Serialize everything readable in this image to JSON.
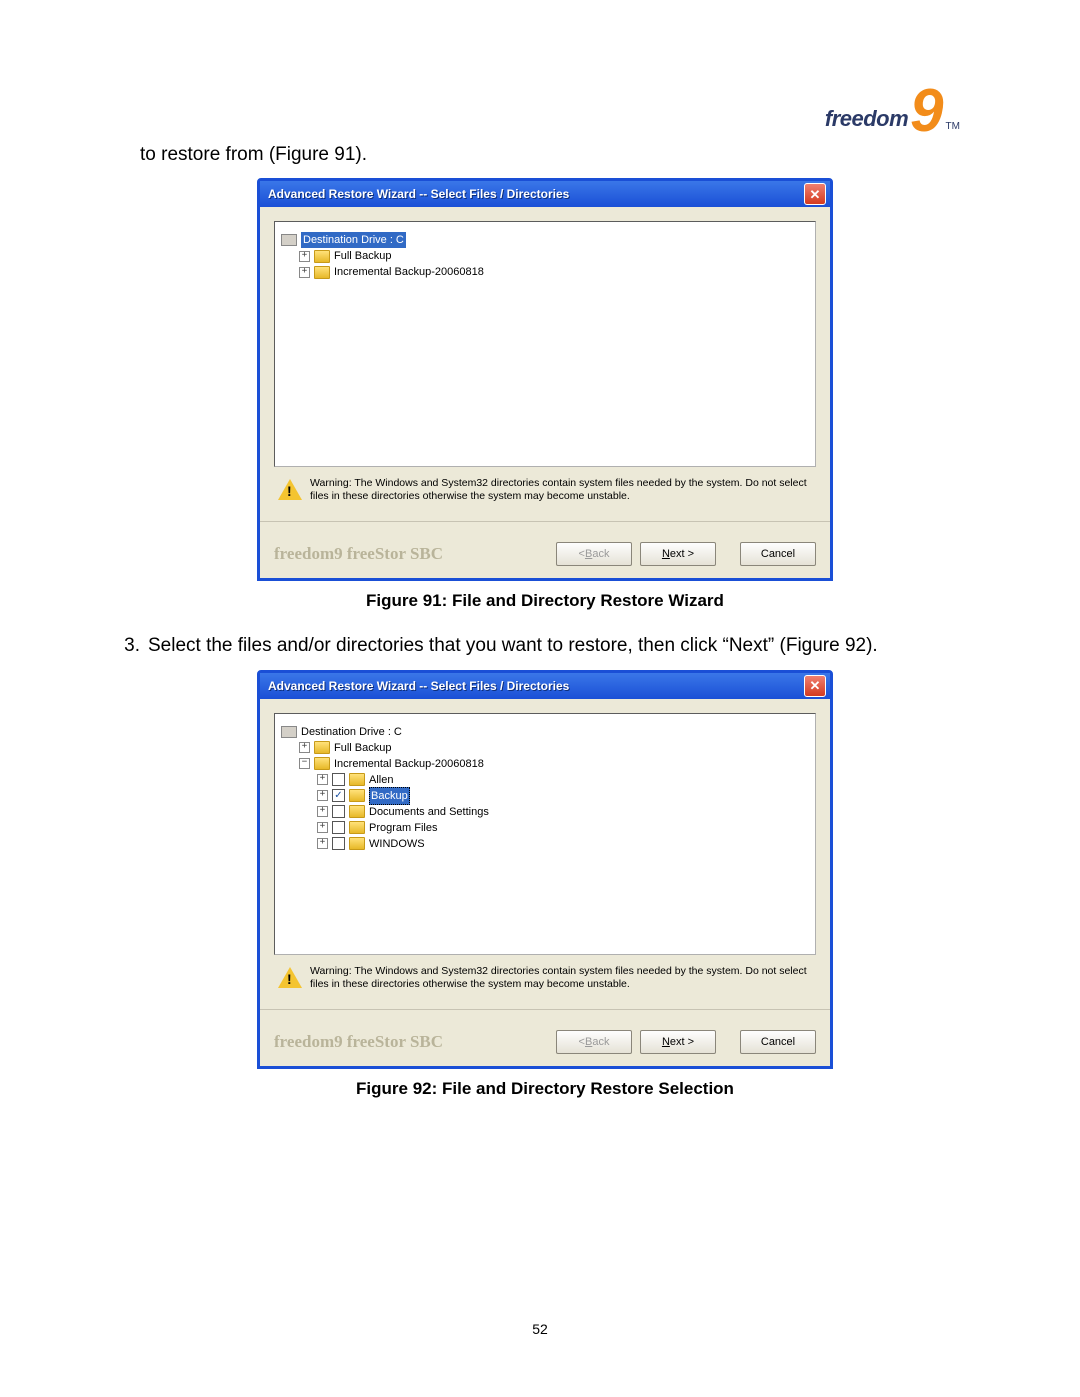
{
  "logo": {
    "word": "freedom",
    "nine": "9",
    "tm": "TM"
  },
  "intro": "to restore from (Figure 91).",
  "step3_num": "3.",
  "step3_text": "Select the files and/or directories that you want to restore, then click “Next” (Figure 92).",
  "page_number": "52",
  "dialog_title": "Advanced Restore Wizard -- Select Files / Directories",
  "close_glyph": "✕",
  "warning_text": "Warning: The Windows and System32 directories contain system files needed by the system. Do not select files in these directories otherwise the system may become unstable.",
  "footer_brand": "freedom9 freeStor SBC",
  "btn_back": "< Back",
  "btn_back_u": "B",
  "btn_next": "Next >",
  "btn_next_u": "N",
  "btn_cancel": "Cancel",
  "fig91": {
    "caption": "Figure 91: File and Directory Restore Wizard",
    "root": "Destination Drive : C",
    "items": [
      {
        "exp": "+",
        "label": "Full Backup"
      },
      {
        "exp": "+",
        "label": "Incremental Backup-20060818"
      }
    ]
  },
  "fig92": {
    "caption": "Figure 92: File and Directory Restore Selection",
    "root": "Destination Drive : C",
    "items": [
      {
        "exp": "+",
        "label": "Full Backup",
        "level": 1
      },
      {
        "exp": "−",
        "label": "Incremental Backup-20060818",
        "level": 1
      }
    ],
    "children": [
      {
        "exp": "+",
        "chk": false,
        "label": "Allen"
      },
      {
        "exp": "+",
        "chk": true,
        "label": "Backup",
        "selected": true
      },
      {
        "exp": "+",
        "chk": false,
        "label": "Documents and Settings"
      },
      {
        "exp": "+",
        "chk": false,
        "label": "Program Files"
      },
      {
        "exp": "+",
        "chk": false,
        "label": "WINDOWS"
      }
    ]
  }
}
